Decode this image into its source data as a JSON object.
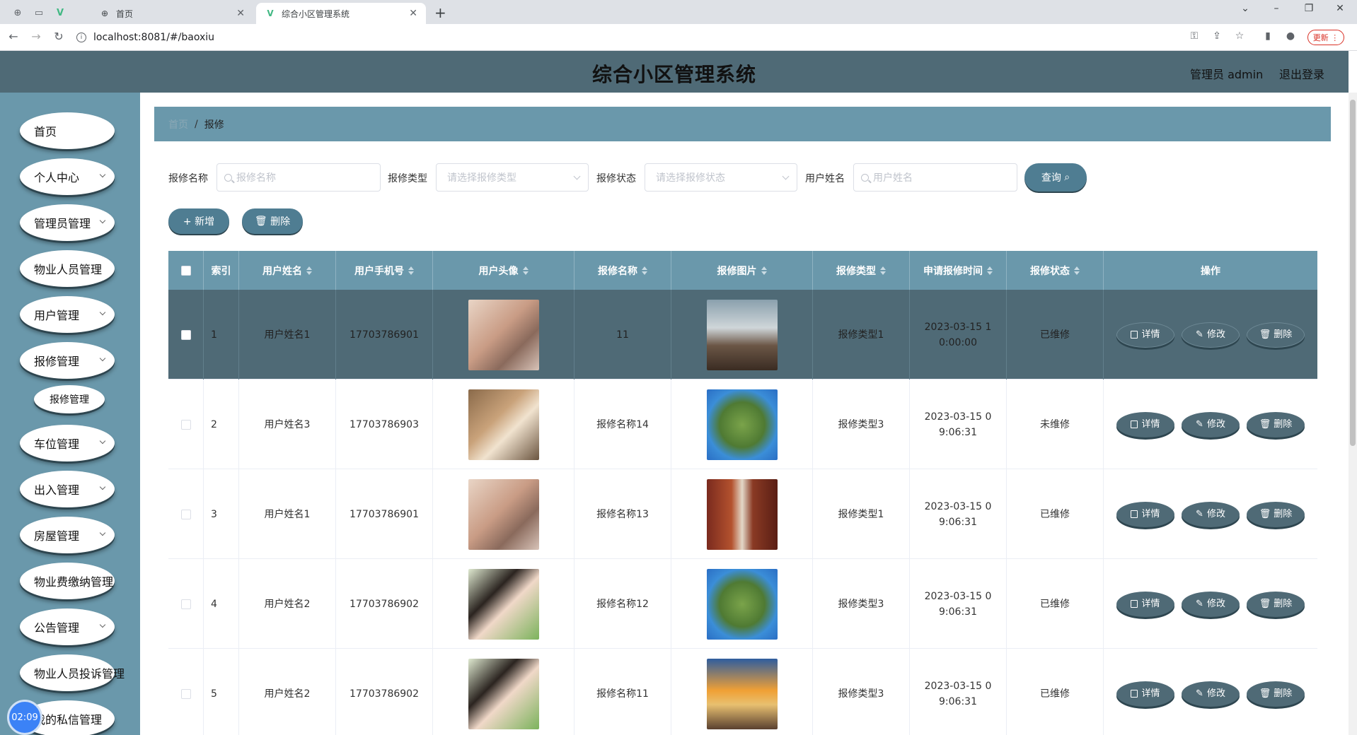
{
  "browser": {
    "tabs": [
      {
        "label": "首页"
      },
      {
        "label": "综合小区管理系统"
      }
    ],
    "url": "localhost:8081/#/baoxiu",
    "update_label": "更新"
  },
  "header": {
    "title": "综合小区管理系统",
    "user": "管理员 admin",
    "logout": "退出登录"
  },
  "sidebar": {
    "items": [
      {
        "label": "首页",
        "chevron": false
      },
      {
        "label": "个人中心",
        "chevron": true
      },
      {
        "label": "管理员管理",
        "chevron": true
      },
      {
        "label": "物业人员管理",
        "chevron": false
      },
      {
        "label": "用户管理",
        "chevron": true
      },
      {
        "label": "报修管理",
        "chevron": true
      },
      {
        "label": "车位管理",
        "chevron": true
      },
      {
        "label": "出入管理",
        "chevron": true
      },
      {
        "label": "房屋管理",
        "chevron": true
      },
      {
        "label": "物业费缴纳管理",
        "chevron": false
      },
      {
        "label": "公告管理",
        "chevron": true
      },
      {
        "label": "物业人员投诉管理",
        "chevron": false
      },
      {
        "label": "我的私信管理",
        "chevron": false
      }
    ],
    "sub_item": "报修管理",
    "clock": "02:09"
  },
  "breadcrumb": {
    "home": "首页",
    "separator": "/",
    "current": "报修"
  },
  "search": {
    "fields": [
      {
        "label": "报修名称",
        "placeholder": "报修名称",
        "type": "input"
      },
      {
        "label": "报修类型",
        "placeholder": "请选择报修类型",
        "type": "select"
      },
      {
        "label": "报修状态",
        "placeholder": "请选择报修状态",
        "type": "select"
      },
      {
        "label": "用户姓名",
        "placeholder": "用户姓名",
        "type": "input"
      }
    ],
    "query_label": "查询"
  },
  "actions": {
    "add_label": "+ 新增",
    "delete_label": "删除"
  },
  "table": {
    "headers": [
      "索引",
      "用户姓名",
      "用户手机号",
      "用户头像",
      "报修名称",
      "报修图片",
      "报修类型",
      "申请报修时间",
      "报修状态",
      "操作"
    ],
    "rows": [
      {
        "index": "1",
        "name": "用户姓名1",
        "phone": "17703786901",
        "title": "11",
        "type": "报修类型1",
        "time": "2023-03-15 10:00:00",
        "status": "已维修"
      },
      {
        "index": "2",
        "name": "用户姓名3",
        "phone": "17703786903",
        "title": "报修名称14",
        "type": "报修类型3",
        "time": "2023-03-15 09:06:31",
        "status": "未维修"
      },
      {
        "index": "3",
        "name": "用户姓名1",
        "phone": "17703786901",
        "title": "报修名称13",
        "type": "报修类型1",
        "time": "2023-03-15 09:06:31",
        "status": "已维修"
      },
      {
        "index": "4",
        "name": "用户姓名2",
        "phone": "17703786902",
        "title": "报修名称12",
        "type": "报修类型3",
        "time": "2023-03-15 09:06:31",
        "status": "已维修"
      },
      {
        "index": "5",
        "name": "用户姓名2",
        "phone": "17703786902",
        "title": "报修名称11",
        "type": "报修类型3",
        "time": "2023-03-15 09:06:31",
        "status": "已维修"
      }
    ],
    "op_labels": {
      "detail": "详情",
      "edit": "修改",
      "delete": "删除"
    }
  }
}
